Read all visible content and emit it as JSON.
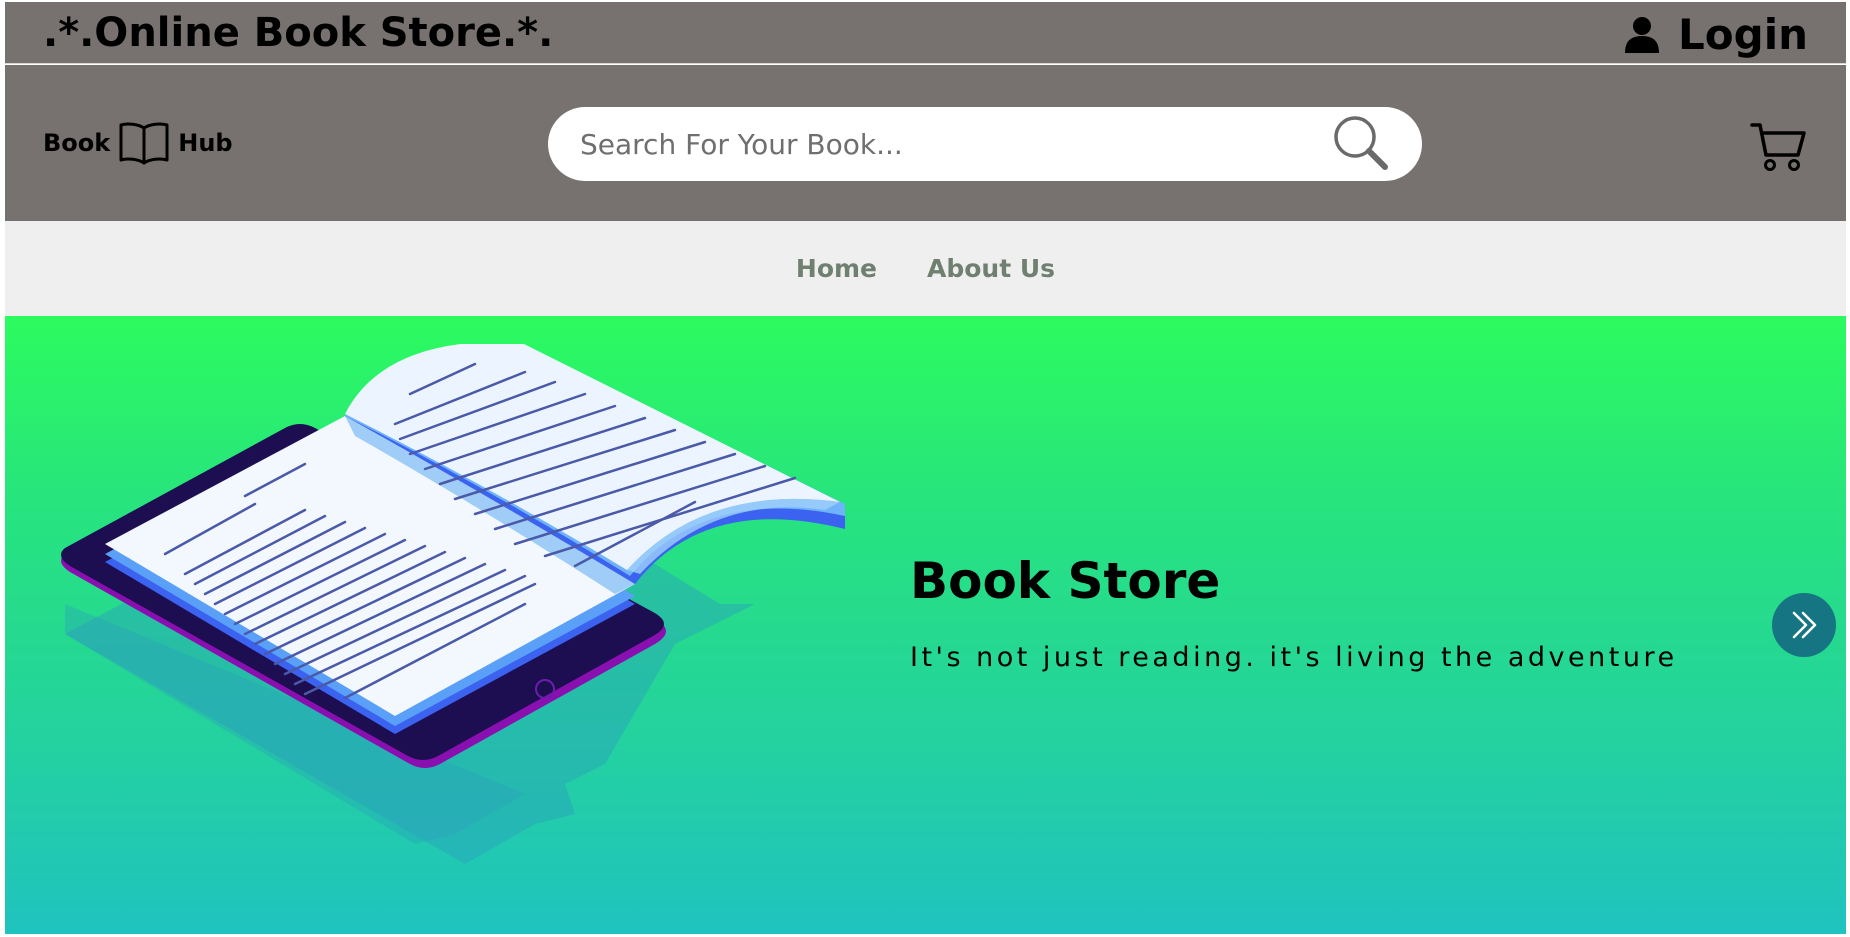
{
  "topbar": {
    "store_name": ".*.Online Book Store.*.",
    "login_label": "Login",
    "login_icon": "user-icon"
  },
  "header": {
    "logo_left": "Book",
    "logo_icon": "open-book-icon",
    "logo_right": "Hub",
    "search": {
      "placeholder": "Search For Your Book...",
      "value": "",
      "icon": "search-icon"
    },
    "cart_icon": "cart-icon"
  },
  "nav": {
    "items": [
      {
        "label": "Home"
      },
      {
        "label": "About Us"
      }
    ]
  },
  "hero": {
    "title": "Book Store",
    "subtitle": "It's not just reading. it's living the adventure",
    "next_icon": "chevron-double-right-icon"
  },
  "colors": {
    "header_bg": "#77726f",
    "nav_bg": "#efefef",
    "nav_text": "#708070",
    "hero_gradient_top": "#2cfb5e",
    "hero_gradient_bottom": "#1fc3bf",
    "next_button": "#157582"
  }
}
